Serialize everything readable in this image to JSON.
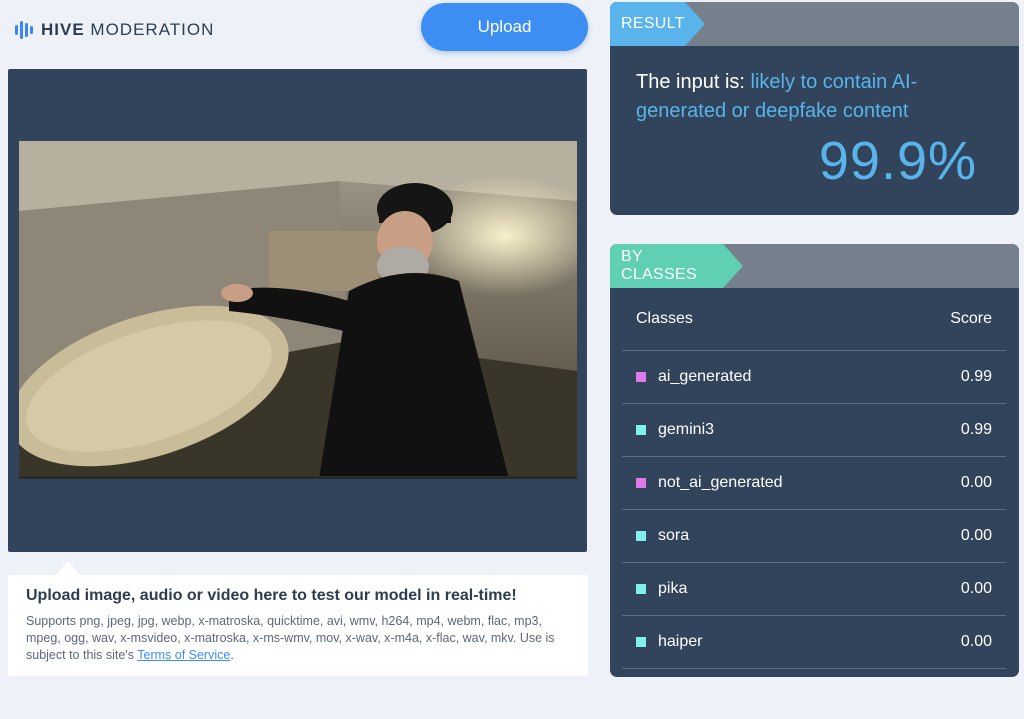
{
  "brand": {
    "bold": "HIVE",
    "rest": "MODERATION"
  },
  "upload": {
    "label": "Upload"
  },
  "hint": {
    "title": "Upload image, audio or video here to test our model in real-time!",
    "body": "Supports png, jpeg, jpg, webp, x-matroska, quicktime, avi, wmv, h264, mp4, webm, flac, mp3, mpeg, ogg, wav, x-msvideo, x-matroska, x-ms-wmv, mov, x-wav, x-m4a, x-flac, wav, mkv. Use is subject to this site's ",
    "link": "Terms of Service",
    "end": "."
  },
  "result": {
    "tag": "RESULT",
    "prefix": "The input is: ",
    "verdict": "likely to contain AI-generated or deepfake content",
    "percent": "99.9%"
  },
  "classes": {
    "tag": "BY CLASSES",
    "col_class": "Classes",
    "col_score": "Score",
    "rows": [
      {
        "name": "ai_generated",
        "score": "0.99"
      },
      {
        "name": "gemini3",
        "score": "0.99"
      },
      {
        "name": "not_ai_generated",
        "score": "0.00"
      },
      {
        "name": "sora",
        "score": "0.00"
      },
      {
        "name": "pika",
        "score": "0.00"
      },
      {
        "name": "haiper",
        "score": "0.00"
      }
    ]
  },
  "colors": {
    "accent_blue": "#3d8ef2",
    "result_blue": "#58b4ea",
    "classes_green": "#5fd0b4",
    "card_bg": "#32445c",
    "dot_magenta": "#e07ae8",
    "dot_cyan": "#7ff0ec"
  }
}
